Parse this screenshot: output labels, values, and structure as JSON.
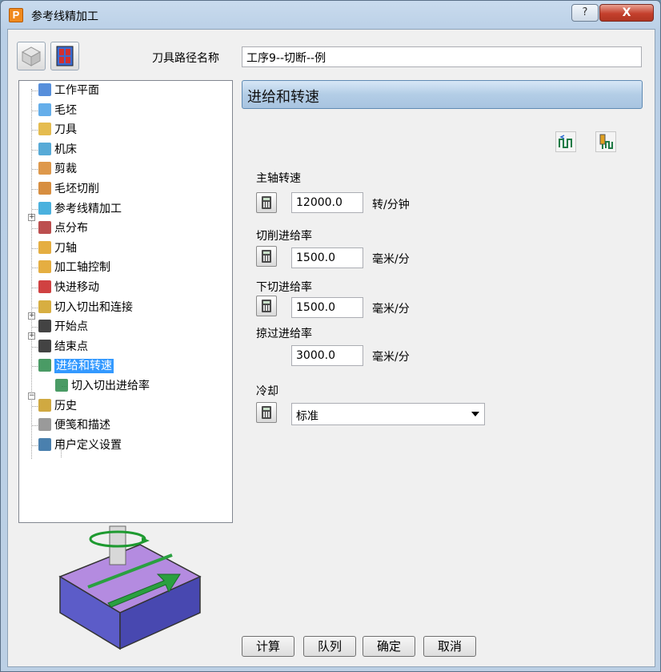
{
  "window": {
    "title": "参考线精加工",
    "help_glyph": "?",
    "close_glyph": "X"
  },
  "header": {
    "toolpath_name_label": "刀具路径名称",
    "toolpath_name_value": "工序9--切断--例"
  },
  "tree": {
    "items": [
      {
        "label": "工作平面",
        "icon": "workplane-icon",
        "color": "#3a7bd5"
      },
      {
        "label": "毛坯",
        "icon": "block-icon",
        "color": "#4aa0e6"
      },
      {
        "label": "刀具",
        "icon": "tool-icon",
        "color": "#e0b030"
      },
      {
        "label": "机床",
        "icon": "machine-icon",
        "color": "#3a9bd0"
      },
      {
        "label": "剪裁",
        "icon": "limit-icon",
        "color": "#d8862c"
      },
      {
        "label": "毛坯切削",
        "icon": "stock-cut-icon",
        "color": "#d07a1e"
      },
      {
        "label": "参考线精加工",
        "icon": "pattern-finish-icon",
        "color": "#2aa3d8"
      },
      {
        "label": "点分布",
        "icon": "point-distribution-icon",
        "color": "#b03030"
      },
      {
        "label": "刀轴",
        "icon": "tool-axis-icon",
        "color": "#e0a020"
      },
      {
        "label": "加工轴控制",
        "icon": "axis-control-icon",
        "color": "#e0a020"
      },
      {
        "label": "快进移动",
        "icon": "rapid-move-icon",
        "color": "#c82020"
      },
      {
        "label": "切入切出和连接",
        "icon": "lead-link-icon",
        "color": "#d0a020"
      },
      {
        "label": "开始点",
        "icon": "start-point-icon",
        "color": "#222222"
      },
      {
        "label": "结束点",
        "icon": "end-point-icon",
        "color": "#222222"
      },
      {
        "label": "进给和转速",
        "icon": "feeds-speeds-icon",
        "color": "#2a8a4a"
      },
      {
        "label": "切入切出进给率",
        "icon": "lead-feed-icon",
        "color": "#2a8a4a"
      },
      {
        "label": "历史",
        "icon": "history-icon",
        "color": "#c89a20"
      },
      {
        "label": "便笺和描述",
        "icon": "notes-icon",
        "color": "#888888"
      },
      {
        "label": "用户定义设置",
        "icon": "user-settings-icon",
        "color": "#2a6aa0"
      }
    ]
  },
  "panel": {
    "title": "进给和转速",
    "spindle_speed_label": "主轴转速",
    "spindle_speed_value": "12000.0",
    "spindle_speed_unit": "转/分钟",
    "cutting_feed_label": "切削进给率",
    "cutting_feed_value": "1500.0",
    "cutting_feed_unit": "毫米/分",
    "plunge_feed_label": "下切进给率",
    "plunge_feed_value": "1500.0",
    "plunge_feed_unit": "毫米/分",
    "skim_feed_label": "掠过进给率",
    "skim_feed_value": "3000.0",
    "skim_feed_unit": "毫米/分",
    "coolant_label": "冷却",
    "coolant_value": "标准"
  },
  "buttons": {
    "calculate": "计算",
    "queue": "队列",
    "ok": "确定",
    "cancel": "取消"
  }
}
